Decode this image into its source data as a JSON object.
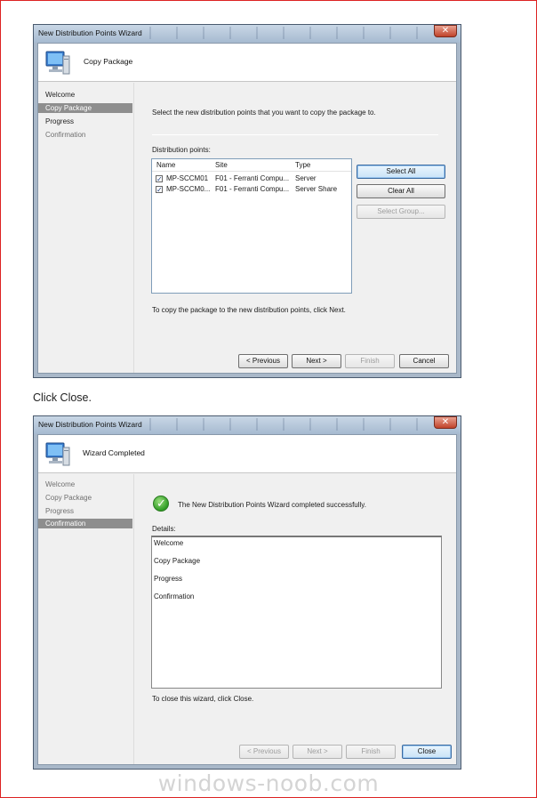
{
  "wizard1": {
    "window_title": "New Distribution Points Wizard",
    "close_glyph": "✕",
    "header_title": "Copy Package",
    "header_icon": "computer-icon",
    "nav": [
      {
        "label": "Welcome",
        "state": "normal"
      },
      {
        "label": "Copy Package",
        "state": "active"
      },
      {
        "label": "Progress",
        "state": "normal"
      },
      {
        "label": "Confirmation",
        "state": "disabled"
      }
    ],
    "instruction": "Select the new distribution points that you want to copy the package to.",
    "dp_label": "Distribution points:",
    "columns": [
      "Name",
      "Site",
      "Type"
    ],
    "rows": [
      {
        "checked": true,
        "name": "MP-SCCM01",
        "site": "F01 - Ferranti Compu...",
        "type": "Server"
      },
      {
        "checked": true,
        "name": "MP-SCCM0...",
        "site": "F01 - Ferranti Compu...",
        "type": "Server Share"
      }
    ],
    "check_glyph": "✓",
    "select_all": "Select All",
    "clear_all": "Clear All",
    "select_group": "Select Group...",
    "footer_text": "To copy the package to the new distribution points, click Next.",
    "buttons": {
      "previous": "< Previous",
      "next": "Next >",
      "finish": "Finish",
      "cancel": "Cancel"
    }
  },
  "caption": "Click Close.",
  "wizard2": {
    "window_title": "New Distribution Points Wizard",
    "close_glyph": "✕",
    "header_title": "Wizard Completed",
    "header_icon": "computer-icon",
    "nav": [
      {
        "label": "Welcome",
        "state": "disabled"
      },
      {
        "label": "Copy Package",
        "state": "disabled"
      },
      {
        "label": "Progress",
        "state": "disabled"
      },
      {
        "label": "Confirmation",
        "state": "active"
      }
    ],
    "success_icon": "success-check-icon",
    "success_glyph": "✓",
    "success_message": "The New Distribution Points Wizard completed successfully.",
    "details_label": "Details:",
    "details": [
      "Welcome",
      "Copy Package",
      "Progress",
      "Confirmation"
    ],
    "footer_text": "To close this wizard, click Close.",
    "buttons": {
      "previous": "< Previous",
      "next": "Next >",
      "finish": "Finish",
      "close": "Close"
    }
  },
  "watermark": "windows-noob.com"
}
